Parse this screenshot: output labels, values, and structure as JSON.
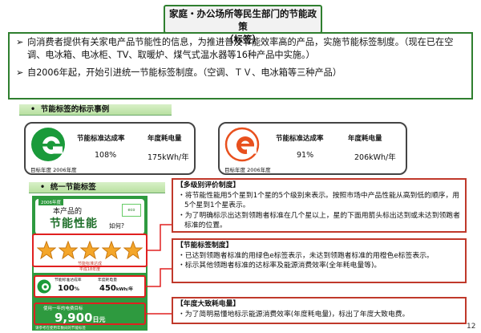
{
  "title": {
    "line1": "家庭・办公场所等民生部门的节能政策",
    "line2": "（标签）"
  },
  "intro": {
    "bullet1": "向消费者提供有关家电产品节能性的信息，为推进普及节能效率高的产品，实施节能标签制度。（现在已在空调、电冰箱、电冰柜、TV、取暖炉、煤气式温水器等16种产品中实施。）",
    "bullet2": "自2006年起，开始引进统一节能标签制度。（空调、ＴＶ、电冰箱等三种产品）"
  },
  "section1": {
    "label": "节能标签的标示事例"
  },
  "card1": {
    "col1": "节能标准达成率",
    "col2": "年度耗电量",
    "val1": "108%",
    "val2": "175kWh/年",
    "year": "目标年度  2006年度",
    "color": "#1a9a3a"
  },
  "card2": {
    "col1": "节能标准达成率",
    "col2": "年度耗电量",
    "val1": "91%",
    "val2": "206kWh/年",
    "year": "目标年度  2006年度",
    "color": "#e8501e"
  },
  "section2": {
    "label": "统一节能标签"
  },
  "sample": {
    "year_tag": "2006年度",
    "line1": "本产品的",
    "line2": "节能性能",
    "line3": "如何?",
    "stars": 5,
    "tier_caption1": "节能标准达成",
    "tier_caption2": "平成18年度",
    "std_label": "节能标准达成率",
    "kwh_label": "年度耗电量",
    "std_value": "100",
    "std_unit": "%",
    "kwh_value": "450",
    "kwh_unit": "kWh/年",
    "cost_caption": "使用一年的电费目标",
    "cost_value": "9,900",
    "cost_unit": "日元",
    "footer": "请参考在使用年数间的节能标签"
  },
  "ann1": {
    "head": "【多级别评价制度】",
    "items": [
      "・将节能性能用5个星到1个星的5个级别来表示。按照市场中产品性能从高到低的顺序，用5个星到1个星表示。",
      "・为了明确标示出达到领跑者标准在几个星以上，星的下面用箭头标出达到或未达到领跑者标准的位置。"
    ]
  },
  "ann2": {
    "head": "【节能标签制度】",
    "items": [
      "・已达到领跑者标准的用绿色e标签表示，未达到领跑者标准的用橙色e标签表示。",
      "・标示其他领跑者标准的达标率及能源消费效率(全年耗电量等)。"
    ]
  },
  "ann3": {
    "head": "【年度大致耗电量】",
    "items": [
      "・为了简明易懂地标示能源消费效率(年度耗电量)，标出了年度大致电费。"
    ]
  },
  "page_number": "12"
}
